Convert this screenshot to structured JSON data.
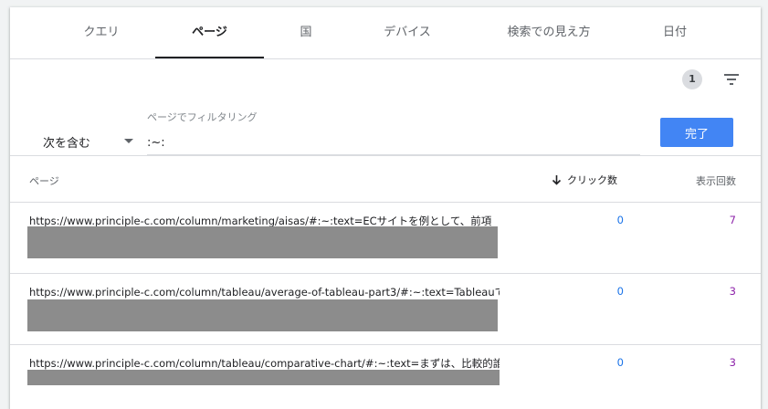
{
  "tabs": [
    {
      "label": "クエリ"
    },
    {
      "label": "ページ"
    },
    {
      "label": "国"
    },
    {
      "label": "デバイス"
    },
    {
      "label": "検索での見え方"
    },
    {
      "label": "日付"
    }
  ],
  "active_tab": "ページ",
  "filter_count": "1",
  "filter": {
    "operator": "次を含む",
    "label": "ページでフィルタリング",
    "value": ":~:",
    "done_label": "完了"
  },
  "table": {
    "columns": {
      "page": "ページ",
      "clicks": "クリック数",
      "impressions": "表示回数"
    },
    "sort_column": "clicks",
    "rows": [
      {
        "url": "https://www.principle-c.com/column/marketing/aisas/#:~:text=ECサイトを例として、前項",
        "clicks": "0",
        "impressions": "7"
      },
      {
        "url": "https://www.principle-c.com/column/tableau/average-of-tableau-part3/#:~:text=Tableauで",
        "clicks": "0",
        "impressions": "3"
      },
      {
        "url": "https://www.principle-c.com/column/tableau/comparative-chart/#:~:text=まずは、比較的誰",
        "clicks": "0",
        "impressions": "3"
      }
    ]
  },
  "colors": {
    "accent": "#4285f4",
    "clicks": "#1a73e8",
    "impressions": "#8e24aa",
    "redaction": "#8c8c8c"
  },
  "icons": {
    "filter": "filter-list-icon",
    "sort": "arrow-down-icon",
    "dropdown": "caret-down-icon"
  }
}
